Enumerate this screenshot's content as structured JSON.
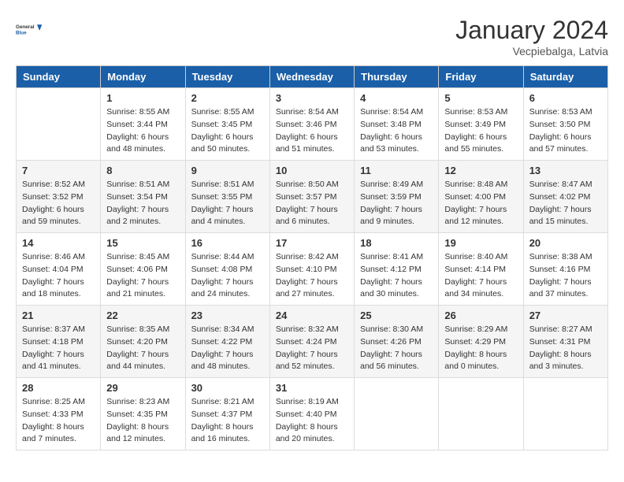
{
  "logo": {
    "line1": "General",
    "line2": "Blue"
  },
  "title": "January 2024",
  "subtitle": "Vecpiebalga, Latvia",
  "weekdays": [
    "Sunday",
    "Monday",
    "Tuesday",
    "Wednesday",
    "Thursday",
    "Friday",
    "Saturday"
  ],
  "weeks": [
    [
      {
        "day": "",
        "info": ""
      },
      {
        "day": "1",
        "info": "Sunrise: 8:55 AM\nSunset: 3:44 PM\nDaylight: 6 hours\nand 48 minutes."
      },
      {
        "day": "2",
        "info": "Sunrise: 8:55 AM\nSunset: 3:45 PM\nDaylight: 6 hours\nand 50 minutes."
      },
      {
        "day": "3",
        "info": "Sunrise: 8:54 AM\nSunset: 3:46 PM\nDaylight: 6 hours\nand 51 minutes."
      },
      {
        "day": "4",
        "info": "Sunrise: 8:54 AM\nSunset: 3:48 PM\nDaylight: 6 hours\nand 53 minutes."
      },
      {
        "day": "5",
        "info": "Sunrise: 8:53 AM\nSunset: 3:49 PM\nDaylight: 6 hours\nand 55 minutes."
      },
      {
        "day": "6",
        "info": "Sunrise: 8:53 AM\nSunset: 3:50 PM\nDaylight: 6 hours\nand 57 minutes."
      }
    ],
    [
      {
        "day": "7",
        "info": "Sunrise: 8:52 AM\nSunset: 3:52 PM\nDaylight: 6 hours\nand 59 minutes."
      },
      {
        "day": "8",
        "info": "Sunrise: 8:51 AM\nSunset: 3:54 PM\nDaylight: 7 hours\nand 2 minutes."
      },
      {
        "day": "9",
        "info": "Sunrise: 8:51 AM\nSunset: 3:55 PM\nDaylight: 7 hours\nand 4 minutes."
      },
      {
        "day": "10",
        "info": "Sunrise: 8:50 AM\nSunset: 3:57 PM\nDaylight: 7 hours\nand 6 minutes."
      },
      {
        "day": "11",
        "info": "Sunrise: 8:49 AM\nSunset: 3:59 PM\nDaylight: 7 hours\nand 9 minutes."
      },
      {
        "day": "12",
        "info": "Sunrise: 8:48 AM\nSunset: 4:00 PM\nDaylight: 7 hours\nand 12 minutes."
      },
      {
        "day": "13",
        "info": "Sunrise: 8:47 AM\nSunset: 4:02 PM\nDaylight: 7 hours\nand 15 minutes."
      }
    ],
    [
      {
        "day": "14",
        "info": "Sunrise: 8:46 AM\nSunset: 4:04 PM\nDaylight: 7 hours\nand 18 minutes."
      },
      {
        "day": "15",
        "info": "Sunrise: 8:45 AM\nSunset: 4:06 PM\nDaylight: 7 hours\nand 21 minutes."
      },
      {
        "day": "16",
        "info": "Sunrise: 8:44 AM\nSunset: 4:08 PM\nDaylight: 7 hours\nand 24 minutes."
      },
      {
        "day": "17",
        "info": "Sunrise: 8:42 AM\nSunset: 4:10 PM\nDaylight: 7 hours\nand 27 minutes."
      },
      {
        "day": "18",
        "info": "Sunrise: 8:41 AM\nSunset: 4:12 PM\nDaylight: 7 hours\nand 30 minutes."
      },
      {
        "day": "19",
        "info": "Sunrise: 8:40 AM\nSunset: 4:14 PM\nDaylight: 7 hours\nand 34 minutes."
      },
      {
        "day": "20",
        "info": "Sunrise: 8:38 AM\nSunset: 4:16 PM\nDaylight: 7 hours\nand 37 minutes."
      }
    ],
    [
      {
        "day": "21",
        "info": "Sunrise: 8:37 AM\nSunset: 4:18 PM\nDaylight: 7 hours\nand 41 minutes."
      },
      {
        "day": "22",
        "info": "Sunrise: 8:35 AM\nSunset: 4:20 PM\nDaylight: 7 hours\nand 44 minutes."
      },
      {
        "day": "23",
        "info": "Sunrise: 8:34 AM\nSunset: 4:22 PM\nDaylight: 7 hours\nand 48 minutes."
      },
      {
        "day": "24",
        "info": "Sunrise: 8:32 AM\nSunset: 4:24 PM\nDaylight: 7 hours\nand 52 minutes."
      },
      {
        "day": "25",
        "info": "Sunrise: 8:30 AM\nSunset: 4:26 PM\nDaylight: 7 hours\nand 56 minutes."
      },
      {
        "day": "26",
        "info": "Sunrise: 8:29 AM\nSunset: 4:29 PM\nDaylight: 8 hours\nand 0 minutes."
      },
      {
        "day": "27",
        "info": "Sunrise: 8:27 AM\nSunset: 4:31 PM\nDaylight: 8 hours\nand 3 minutes."
      }
    ],
    [
      {
        "day": "28",
        "info": "Sunrise: 8:25 AM\nSunset: 4:33 PM\nDaylight: 8 hours\nand 7 minutes."
      },
      {
        "day": "29",
        "info": "Sunrise: 8:23 AM\nSunset: 4:35 PM\nDaylight: 8 hours\nand 12 minutes."
      },
      {
        "day": "30",
        "info": "Sunrise: 8:21 AM\nSunset: 4:37 PM\nDaylight: 8 hours\nand 16 minutes."
      },
      {
        "day": "31",
        "info": "Sunrise: 8:19 AM\nSunset: 4:40 PM\nDaylight: 8 hours\nand 20 minutes."
      },
      {
        "day": "",
        "info": ""
      },
      {
        "day": "",
        "info": ""
      },
      {
        "day": "",
        "info": ""
      }
    ]
  ]
}
